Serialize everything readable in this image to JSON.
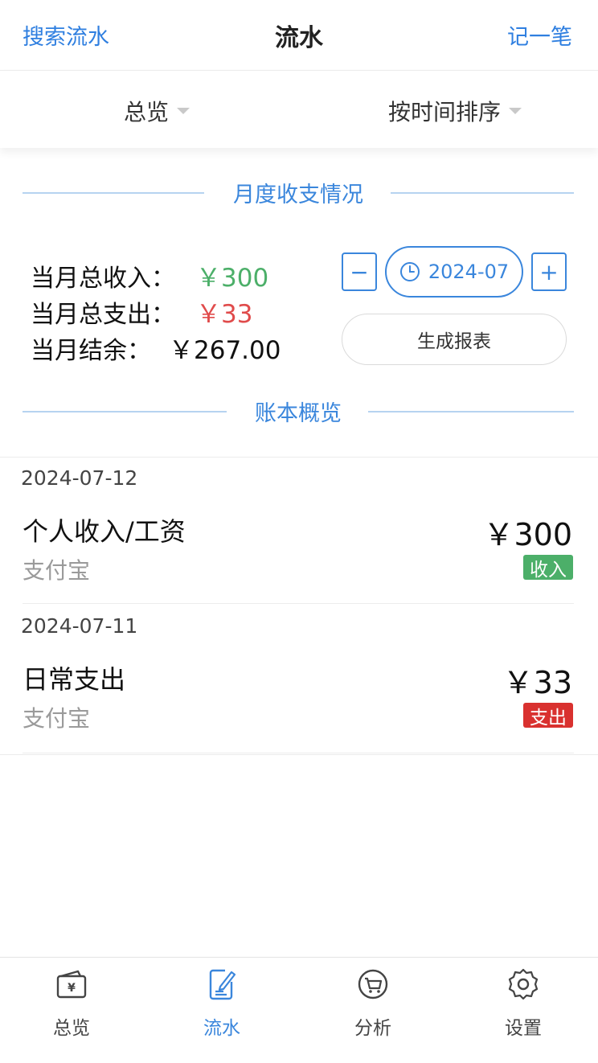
{
  "header": {
    "left_link": "搜索流水",
    "title": "流水",
    "right_link": "记一笔"
  },
  "filters": {
    "overview": "总览",
    "sort": "按时间排序"
  },
  "monthly": {
    "section_title": "月度收支情况",
    "income_label": "当月总收入：",
    "income_value": "￥300",
    "expense_label": "当月总支出：",
    "expense_value": "￥33",
    "balance_label": "当月结余：",
    "balance_value": "￥267.00",
    "minus": "−",
    "plus": "+",
    "month": "2024-07",
    "report_button": "生成报表",
    "colors": {
      "income": "#4caf69",
      "expense": "#e04b4b",
      "accent": "#3a86dc"
    }
  },
  "ledger": {
    "section_title": "账本概览",
    "entries": [
      {
        "date": "2024-07-12",
        "name": "个人收入/工资",
        "account": "支付宝",
        "amount": "￥300",
        "tag": "收入",
        "tag_color": "#4caf69"
      },
      {
        "date": "2024-07-11",
        "name": "日常支出",
        "account": "支付宝",
        "amount": "￥33",
        "tag": "支出",
        "tag_color": "#d9312f"
      }
    ]
  },
  "tabs": [
    {
      "label": "总览",
      "icon": "wallet-icon",
      "active": false
    },
    {
      "label": "流水",
      "icon": "edit-document-icon",
      "active": true
    },
    {
      "label": "分析",
      "icon": "cart-icon",
      "active": false
    },
    {
      "label": "设置",
      "icon": "gear-icon",
      "active": false
    }
  ]
}
